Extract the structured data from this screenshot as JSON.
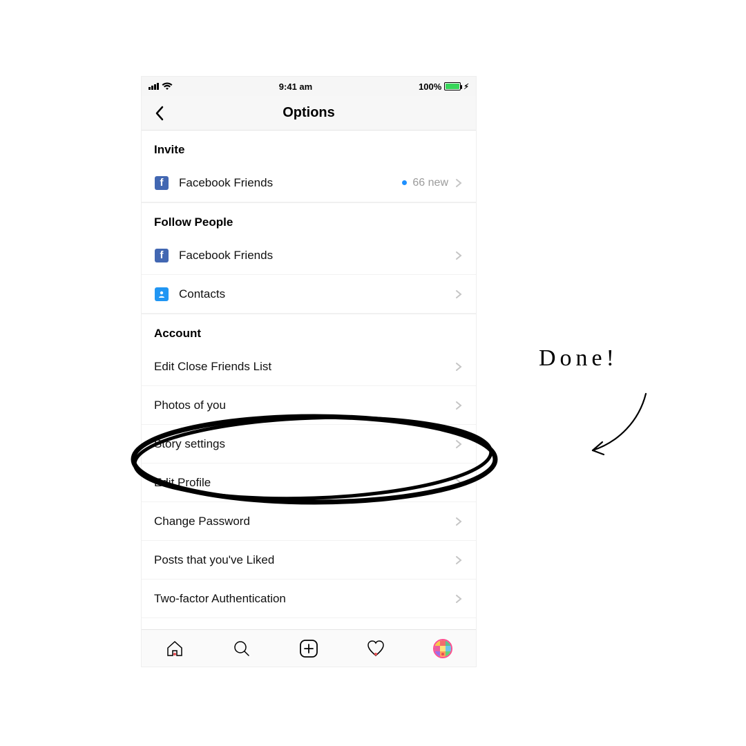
{
  "status": {
    "time": "9:41 am",
    "battery_text": "100%",
    "battery_pct": 100
  },
  "header": {
    "title": "Options"
  },
  "sections": {
    "invite": {
      "header": "Invite",
      "fb_friends_label": "Facebook Friends",
      "fb_friends_trail": "66 new"
    },
    "follow": {
      "header": "Follow People",
      "fb_friends_label": "Facebook Friends",
      "contacts_label": "Contacts"
    },
    "account": {
      "header": "Account",
      "edit_close_friends": "Edit Close Friends List",
      "photos_of_you": "Photos of you",
      "story_settings": "Story settings",
      "edit_profile": "Edit Profile",
      "change_password": "Change Password",
      "posts_liked": "Posts that you've Liked",
      "two_factor": "Two-factor Authentication"
    }
  },
  "annotation": {
    "done": "Done!"
  }
}
